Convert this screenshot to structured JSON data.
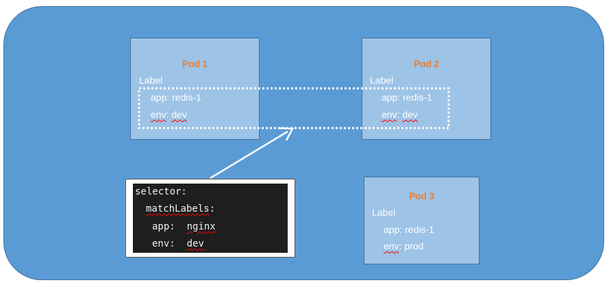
{
  "pods": [
    {
      "title": "Pod 1",
      "label_heading": "Label",
      "app_key": "app",
      "app_value": "redis-1",
      "env_key": "env",
      "env_value": "dev"
    },
    {
      "title": "Pod 2",
      "label_heading": "Label",
      "app_key": "app",
      "app_value": "redis-1",
      "env_key": "env",
      "env_value": "dev"
    },
    {
      "title": "Pod 3",
      "label_heading": "Label",
      "app_key": "app",
      "app_value": "redis-1",
      "env_key": "env",
      "env_value": "prod"
    }
  ],
  "selector": {
    "line1": "selector:",
    "line2_key": "matchLabels",
    "line2_colon": ":",
    "line3_key": "app",
    "line3_value": "nginx",
    "line4_key": "env",
    "line4_value": "dev"
  },
  "colors": {
    "cluster_fill": "#5b9bd5",
    "pod_fill": "#9dc3e6",
    "pod_title": "#ed7d31",
    "code_background": "#1e1e1e",
    "spellcheck_underline": "#ff0000"
  }
}
